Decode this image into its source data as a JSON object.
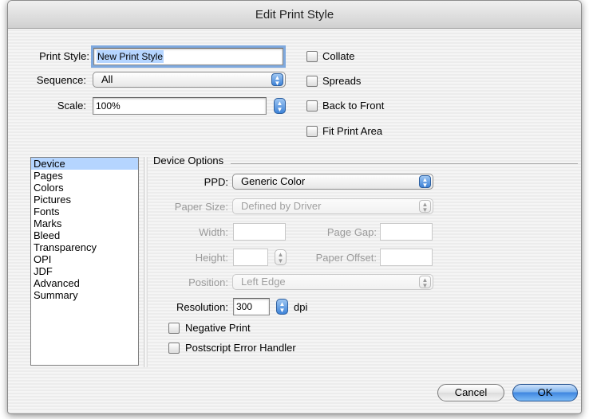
{
  "window": {
    "title": "Edit Print Style"
  },
  "top": {
    "print_style_label": "Print Style:",
    "print_style_value": "New Print Style",
    "sequence_label": "Sequence:",
    "sequence_value": "All",
    "scale_label": "Scale:",
    "scale_value": "100%"
  },
  "checks": {
    "collate": "Collate",
    "spreads": "Spreads",
    "back_to_front": "Back to Front",
    "fit_print_area": "Fit Print Area"
  },
  "sidebar": {
    "items": [
      {
        "label": "Device"
      },
      {
        "label": "Pages"
      },
      {
        "label": "Colors"
      },
      {
        "label": "Pictures"
      },
      {
        "label": "Fonts"
      },
      {
        "label": "Marks"
      },
      {
        "label": "Bleed"
      },
      {
        "label": "Transparency"
      },
      {
        "label": "OPI"
      },
      {
        "label": "JDF"
      },
      {
        "label": "Advanced"
      },
      {
        "label": "Summary"
      }
    ],
    "selected": "Device"
  },
  "device": {
    "group_title": "Device Options",
    "ppd_label": "PPD:",
    "ppd_value": "Generic Color",
    "paper_size_label": "Paper Size:",
    "paper_size_value": "Defined by Driver",
    "width_label": "Width:",
    "width_value": "",
    "page_gap_label": "Page Gap:",
    "page_gap_value": "",
    "height_label": "Height:",
    "height_value": "",
    "paper_offset_label": "Paper Offset:",
    "paper_offset_value": "",
    "position_label": "Position:",
    "position_value": "Left Edge",
    "resolution_label": "Resolution:",
    "resolution_value": "300",
    "resolution_unit": "dpi",
    "negative_print": "Negative Print",
    "postscript_error_handler": "Postscript Error Handler"
  },
  "buttons": {
    "cancel": "Cancel",
    "ok": "OK"
  },
  "colors": {
    "selection": "#b5d5ff",
    "default_button": "#3f86e0",
    "aqua_arrow": "#3e83d8"
  }
}
